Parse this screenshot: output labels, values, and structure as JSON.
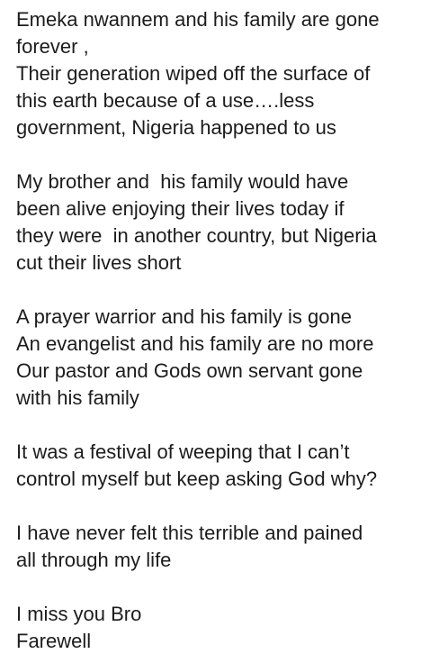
{
  "post": {
    "paragraphs": [
      {
        "lines": [
          "Emeka nwannem and his family are gone",
          "forever ,",
          "Their generation wiped off the surface of",
          "this earth because of a use….less",
          "government, Nigeria happened to us"
        ]
      },
      {
        "lines": [
          "My brother and  his family would have",
          "been alive enjoying their lives today if",
          "they were  in another country, but Nigeria",
          "cut their lives short"
        ]
      },
      {
        "lines": [
          "A prayer warrior and his family is gone",
          "An evangelist and his family are no more",
          "Our pastor and Gods own servant gone",
          "with his family"
        ]
      },
      {
        "lines": [
          "It was a festival of weeping that I can’t",
          "control myself but keep asking God why?"
        ]
      },
      {
        "lines": [
          "I have never felt this terrible and pained",
          "all through my life"
        ]
      },
      {
        "lines": [
          "I miss you Bro",
          "Farewell"
        ]
      }
    ]
  }
}
